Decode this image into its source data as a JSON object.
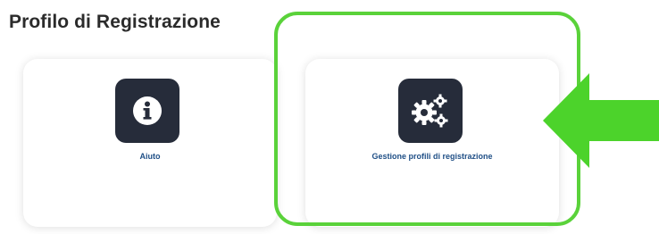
{
  "section": {
    "title": "Profilo di Registrazione"
  },
  "cards": [
    {
      "label": "Aiuto",
      "icon": "info-icon"
    },
    {
      "label": "Gestione profili di registrazione",
      "icon": "gears-icon"
    }
  ],
  "highlight": {
    "color": "#5ad23a",
    "target": "card-gestione-profili"
  },
  "colors": {
    "tile_bg": "#262c3a",
    "label": "#1f4f86",
    "arrow": "#4cd32b"
  }
}
